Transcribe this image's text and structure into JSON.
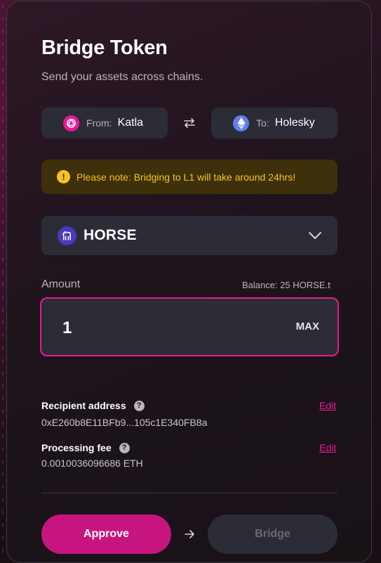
{
  "header": {
    "title": "Bridge Token",
    "subtitle": "Send your assets across chains."
  },
  "chains": {
    "from": {
      "label": "From:",
      "name": "Katla",
      "icon": "katla-logo-icon"
    },
    "to": {
      "label": "To:",
      "name": "Holesky",
      "icon": "ethereum-logo-icon"
    },
    "swap_icon": "swap-arrows-icon"
  },
  "alert": {
    "icon": "exclamation-icon",
    "icon_glyph": "!",
    "text": "Please note: Bridging to L1 will take around 24hrs!"
  },
  "token": {
    "name": "HORSE",
    "icon": "horse-token-icon",
    "chevron": "chevron-down-icon"
  },
  "amount": {
    "label": "Amount",
    "balance": "Balance: 25 HORSE.t",
    "value": "1",
    "max_label": "MAX"
  },
  "recipient": {
    "label": "Recipient address",
    "help_glyph": "?",
    "value": "0xE260b8E11BFb9...105c1E340FB8a",
    "edit_label": "Edit"
  },
  "fee": {
    "label": "Processing fee",
    "help_glyph": "?",
    "value": "0.0010036096686 ETH",
    "edit_label": "Edit"
  },
  "actions": {
    "approve_label": "Approve",
    "bridge_label": "Bridge",
    "step_icon": "arrow-right-icon"
  },
  "colors": {
    "accent": "#e81899",
    "approve": "#c7157f",
    "warning_bg": "#3d300a",
    "warning_text": "#f7c322",
    "surface": "#2b2c35"
  }
}
